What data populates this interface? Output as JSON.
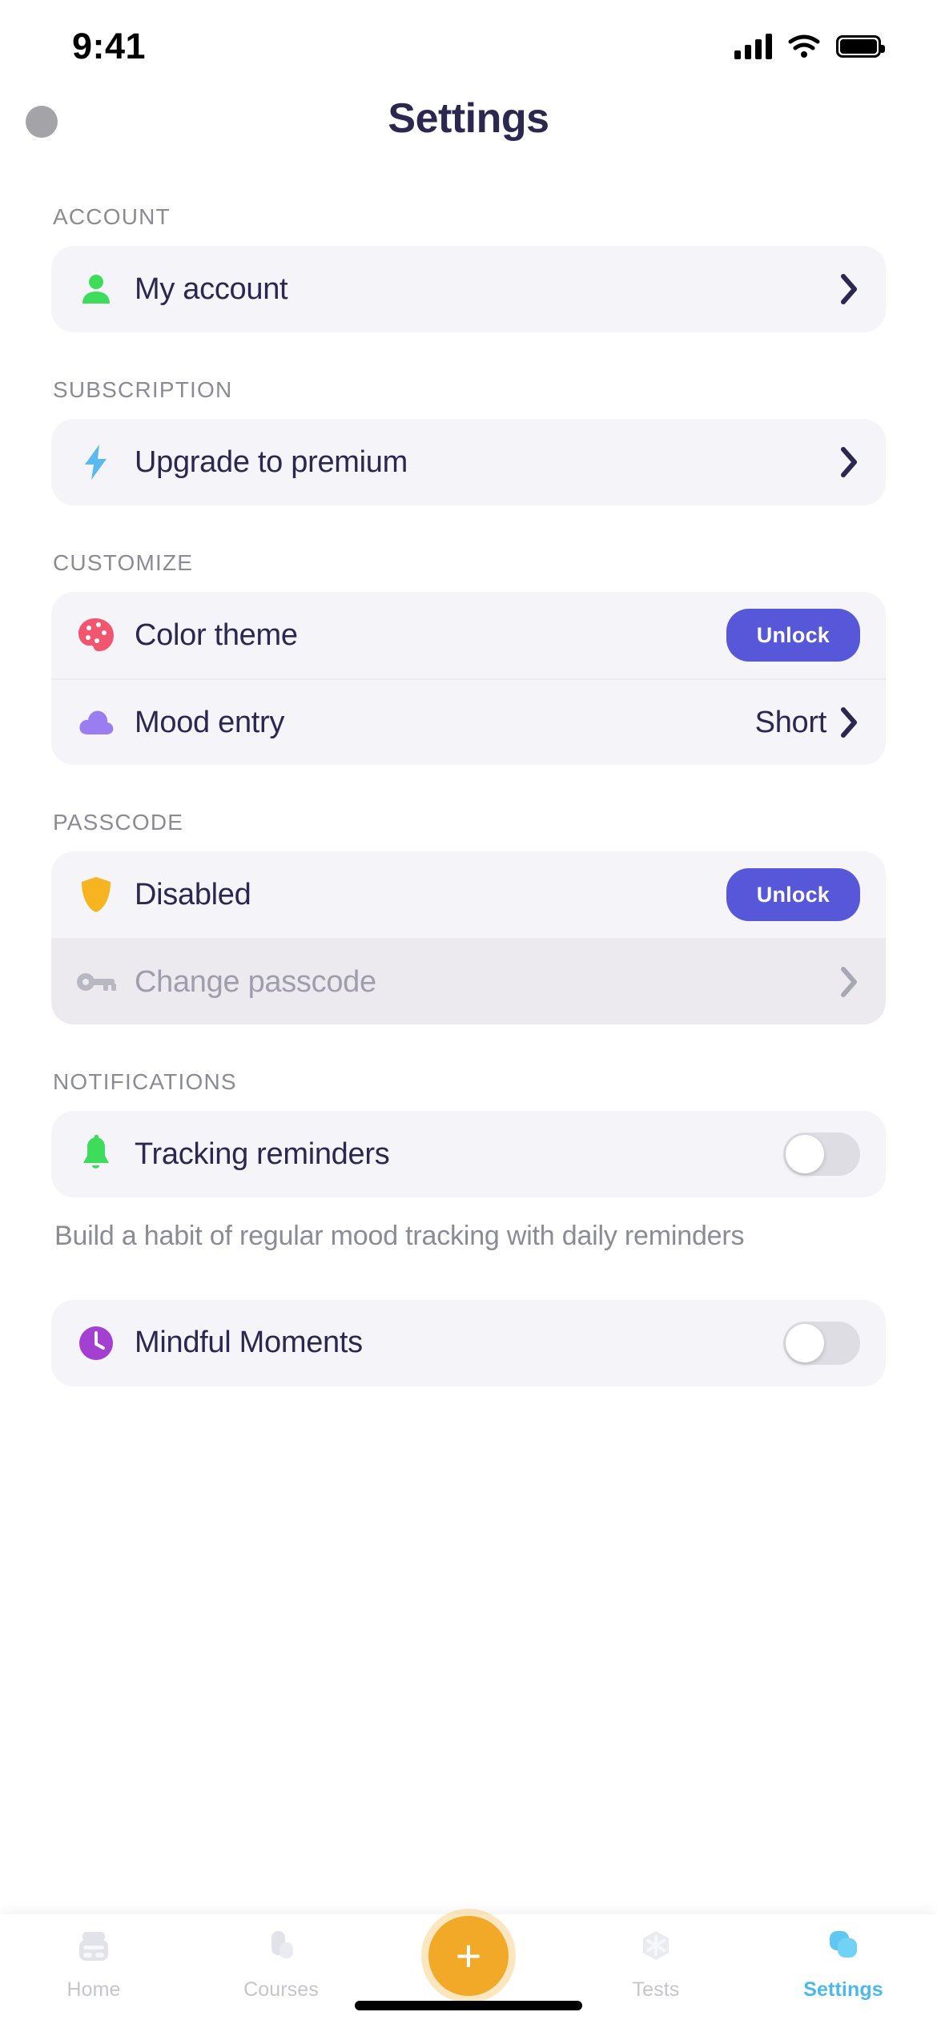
{
  "status_bar": {
    "time": "9:41",
    "cellular_icon": "signal-bars-icon",
    "wifi_icon": "wifi-icon",
    "battery_icon": "battery-full-icon"
  },
  "header": {
    "title": "Settings",
    "avatar": "user-avatar"
  },
  "sections": [
    {
      "label": "ACCOUNT",
      "rows": [
        {
          "icon": "person-icon",
          "label": "My account",
          "accessory": "chevron",
          "value": ""
        }
      ]
    },
    {
      "label": "SUBSCRIPTION",
      "rows": [
        {
          "icon": "lightning-bolt-icon",
          "label": "Upgrade to premium",
          "accessory": "chevron",
          "value": ""
        }
      ]
    },
    {
      "label": "CUSTOMIZE",
      "rows": [
        {
          "icon": "palette-icon",
          "label": "Color theme",
          "accessory": "button",
          "value": "Unlock"
        },
        {
          "icon": "cloud-icon",
          "label": "Mood entry",
          "accessory": "value-chevron",
          "value": "Short"
        }
      ]
    },
    {
      "label": "PASSCODE",
      "rows": [
        {
          "icon": "shield-icon",
          "label": "Disabled",
          "accessory": "button",
          "value": "Unlock"
        },
        {
          "icon": "key-icon",
          "label": "Change passcode",
          "accessory": "chevron",
          "value": "",
          "disabled": true
        }
      ]
    },
    {
      "label": "NOTIFICATIONS",
      "rows": [
        {
          "icon": "bell-icon",
          "label": "Tracking reminders",
          "accessory": "toggle",
          "value": "off"
        }
      ],
      "helper": "Build a habit of regular mood tracking with daily reminders"
    },
    {
      "label": "",
      "rows": [
        {
          "icon": "clock-icon",
          "label": "Mindful Moments",
          "accessory": "toggle",
          "value": "off"
        }
      ]
    }
  ],
  "tabbar": {
    "items": [
      {
        "label": "Home",
        "icon": "journal-icon",
        "active": false
      },
      {
        "label": "Courses",
        "icon": "courses-icon",
        "active": false
      },
      {
        "label": "Tests",
        "icon": "asterisk-hex-icon",
        "active": false
      },
      {
        "label": "Settings",
        "icon": "settings-squares-icon",
        "active": true
      }
    ],
    "fab": {
      "label": "+",
      "icon": "plus-icon"
    }
  },
  "colors": {
    "accent_purple": "#5757d9",
    "card_bg": "#f5f4f8",
    "text_dark": "#2b2750",
    "text_muted": "#8b8b96",
    "fab_orange": "#f2a928",
    "tab_active": "#4cb8ec"
  }
}
